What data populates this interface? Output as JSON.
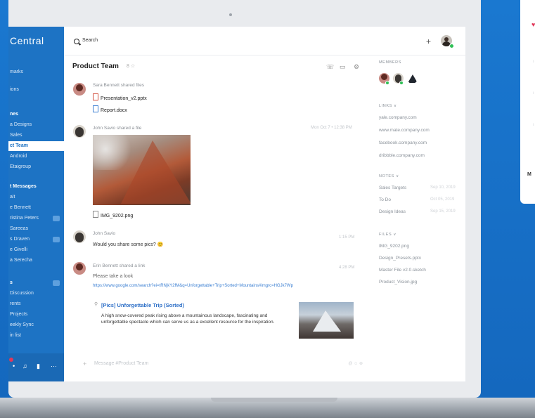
{
  "sidebar": {
    "title": "Central",
    "items": [
      {
        "label": "marks",
        "section": false
      },
      {
        "label": "ions",
        "section": false
      },
      {
        "label": "nes",
        "section": true
      },
      {
        "label": "a Designs",
        "section": false
      },
      {
        "label": "Sales",
        "section": false
      },
      {
        "label": "ct Team",
        "section": false,
        "active": true
      },
      {
        "label": "Android",
        "section": false
      },
      {
        "label": "Etaigroup",
        "section": false
      },
      {
        "label": "t Messages",
        "section": true
      },
      {
        "label": "ait",
        "section": false
      },
      {
        "label": "e Bennett",
        "section": false
      },
      {
        "label": "ristina Peters",
        "section": false
      },
      {
        "label": "Sareeas",
        "section": false
      },
      {
        "label": "s Draven",
        "section": false
      },
      {
        "label": "e Givelli",
        "section": false
      },
      {
        "label": "a Serecha",
        "section": false
      },
      {
        "label": "s",
        "section": true
      },
      {
        "label": "Discussion",
        "section": false
      },
      {
        "label": "rents",
        "section": false
      },
      {
        "label": "Projects",
        "section": false
      },
      {
        "label": "eekly Sync",
        "section": false
      },
      {
        "label": "in list",
        "section": false
      }
    ]
  },
  "topbar": {
    "search_label": "Search",
    "plus": "+"
  },
  "channel": {
    "title": "Product Team",
    "meta": "8 ☆"
  },
  "messages": [
    {
      "head": "Sara Bennett shared files",
      "time": ""
    },
    {
      "head": "John Savio shared a file",
      "time": "Mon Oct 7 • 12:38 PM"
    },
    {
      "head": "John Savio",
      "text": "Would you share some pics? 😊",
      "time": "1:15 PM"
    },
    {
      "head": "Erin Bennett shared a link",
      "text": "Please take a look",
      "time": "4:28 PM"
    }
  ],
  "files": [
    {
      "name": "Presentation_v2.pptx",
      "type": "ppt"
    },
    {
      "name": "Report.docx",
      "type": "doc"
    },
    {
      "name": "IMG_9202.png",
      "type": "img"
    }
  ],
  "link_url": "https://www.google.com/search?ei=tRNjkY2fM&q=Unforgettable+Trip+Sorted+Mountains#imgrc=HGJk7Wp",
  "preview": {
    "title": "[Pics] Unforgettable Trip (Sorted)",
    "desc": "A high snow-covered peak rising above a mountainous landscape, fascinating and unforgettable spectacle which can serve us as a excellent resource for the inspiration."
  },
  "composer": {
    "plus": "+",
    "placeholder": "Message #Product Team",
    "end": "@ ☺ ⊕"
  },
  "right_panel": {
    "members_title": "MEMBERS",
    "links_title": "LINKS ∨",
    "links": [
      "yale.company.com",
      "www.mate.company.com",
      "facebook.company.com",
      "dribbble.company.com"
    ],
    "notes_title": "NOTES ∨",
    "notes": [
      {
        "label": "Sales Targets",
        "meta": "Sep 10, 2019"
      },
      {
        "label": "To Do",
        "meta": "Oct 05, 2019"
      },
      {
        "label": "Design Ideas",
        "meta": "Sep 15, 2019"
      }
    ],
    "files_title": "FILES ∨",
    "files": [
      "IMG_9202.png",
      "Design_Presets.pptx",
      "Master File v2.0.sketch",
      "Product_Vision.jpg"
    ]
  },
  "right_card": {
    "text": "M"
  }
}
